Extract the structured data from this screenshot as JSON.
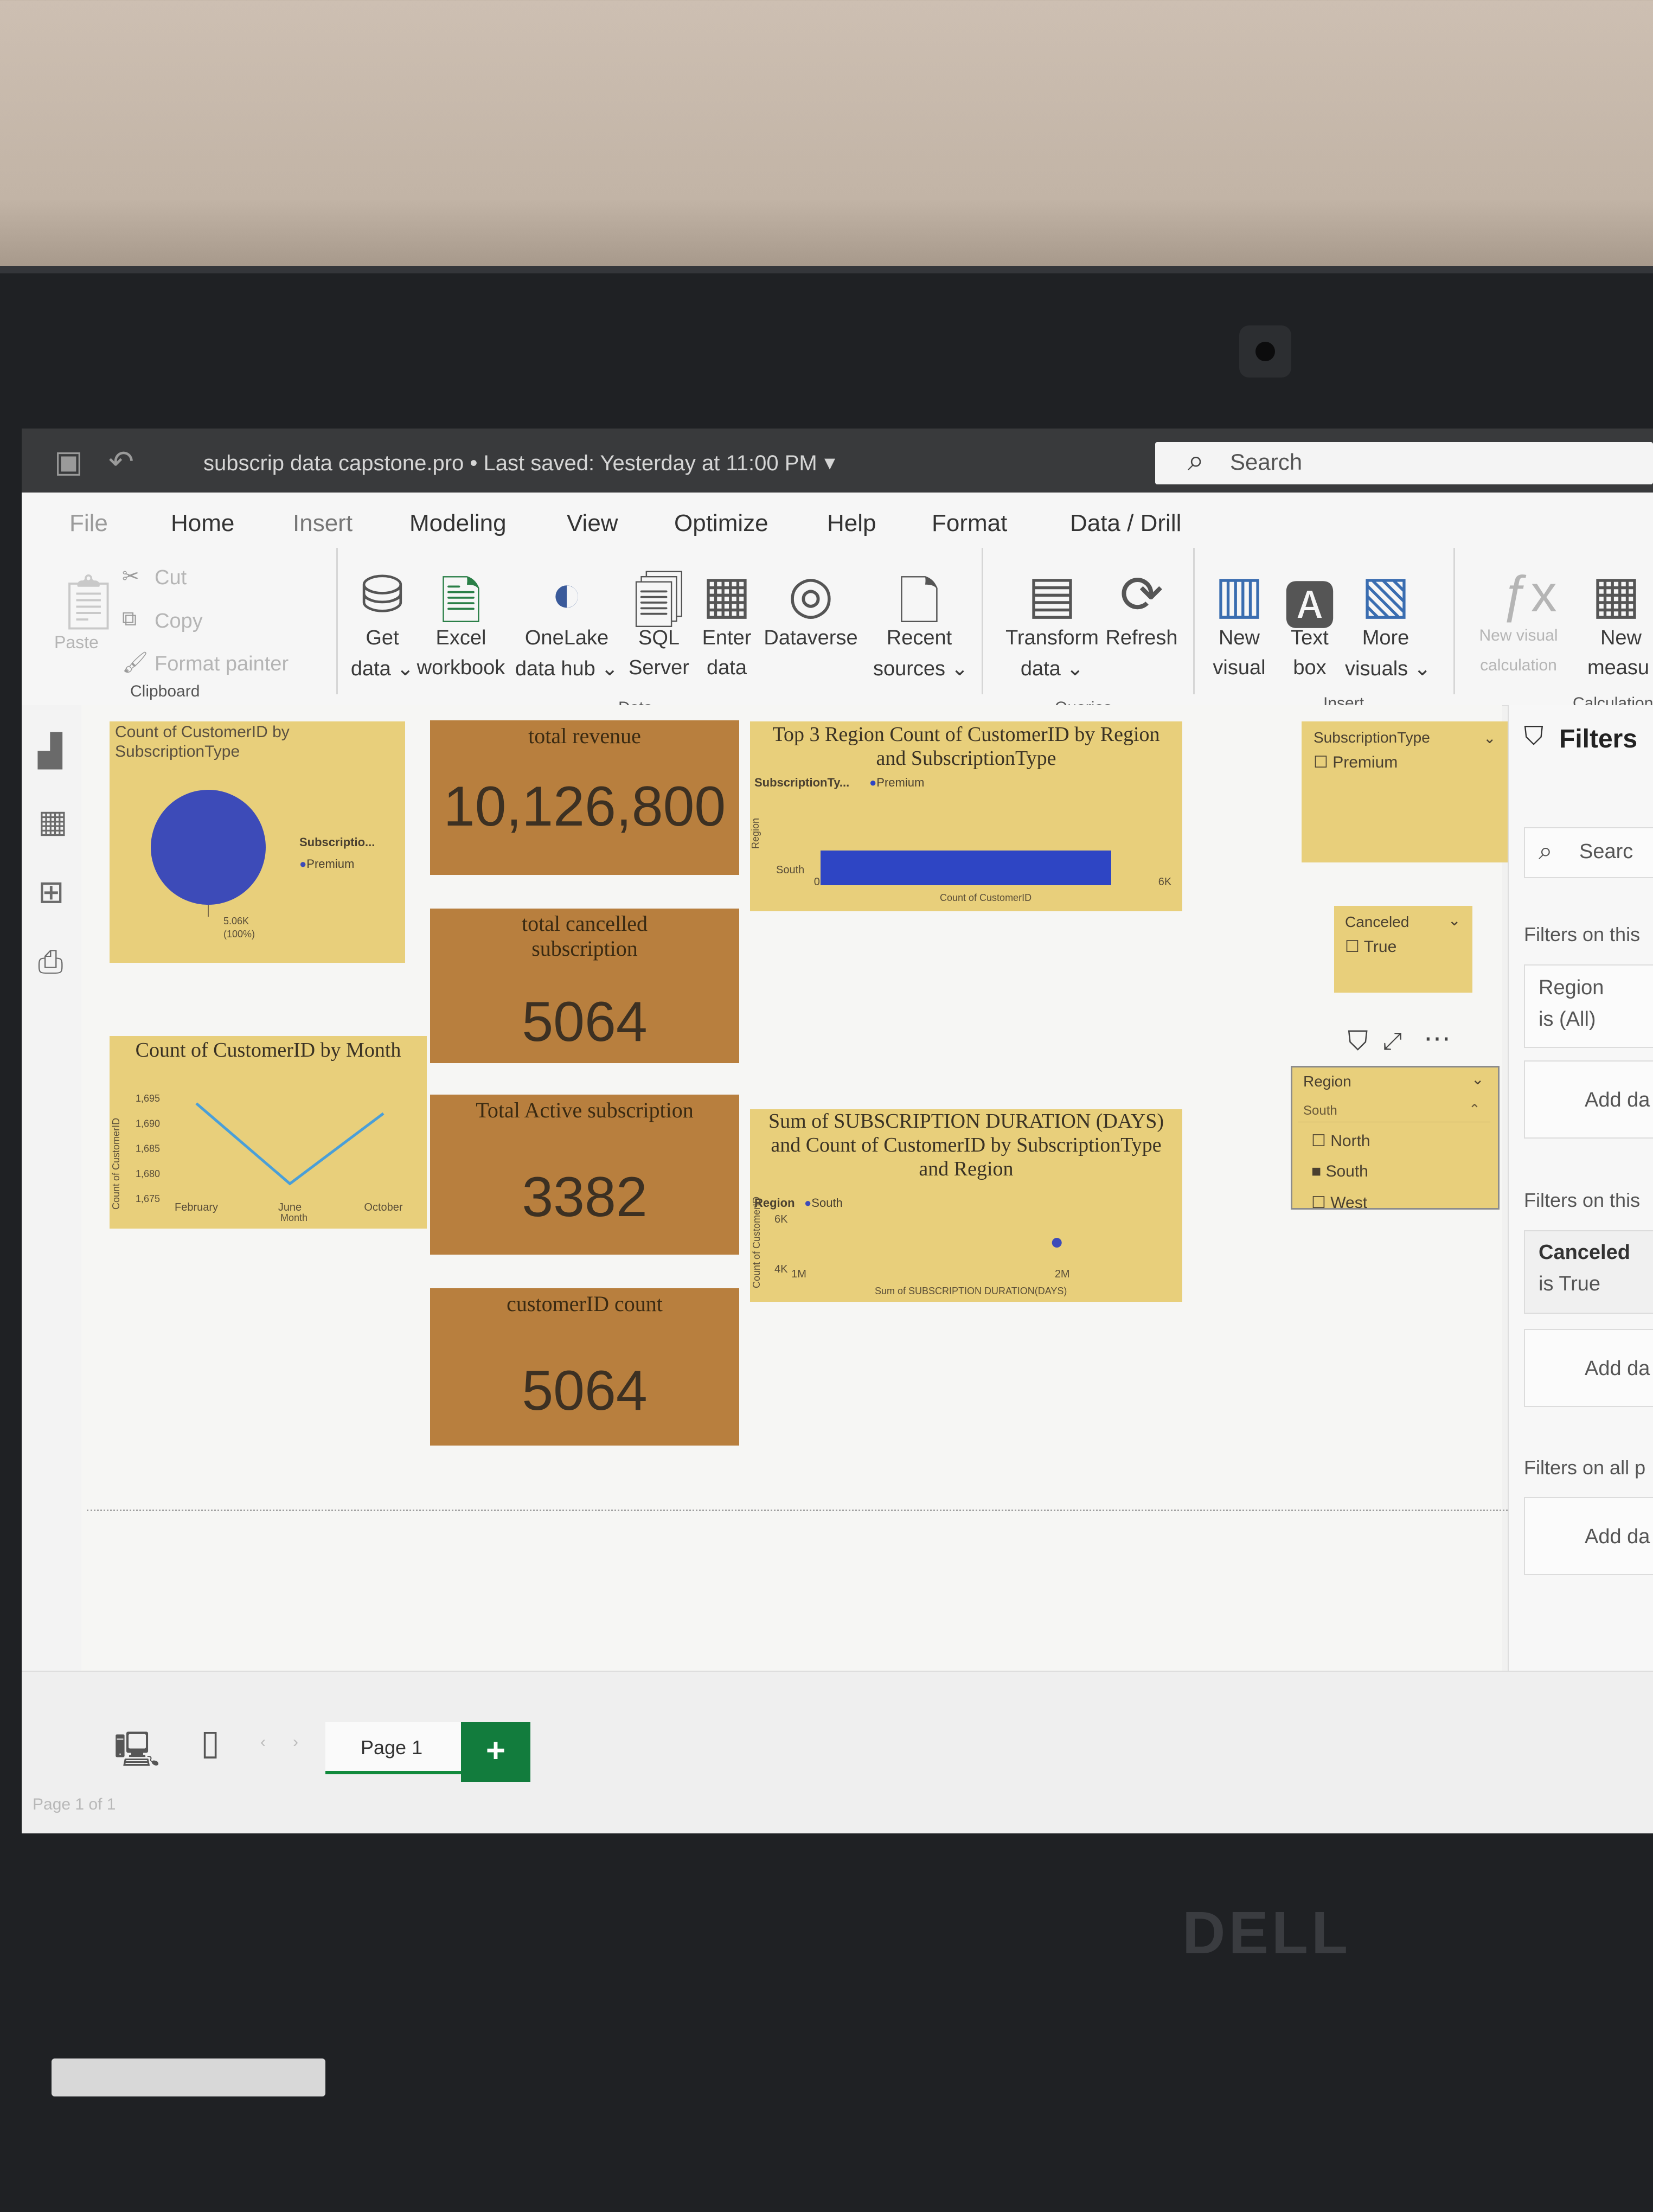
{
  "window": {
    "document_title": "subscrip data capstone.pro • Last saved: Yesterday at 11:00 PM",
    "search_placeholder": "Search"
  },
  "menu_tabs": [
    "File",
    "Home",
    "Insert",
    "Modeling",
    "View",
    "Optimize",
    "Help",
    "Format",
    "Data / Drill"
  ],
  "ribbon": {
    "clipboard": {
      "paste": "Paste",
      "cut": "Cut",
      "copy": "Copy",
      "format_painter": "Format painter",
      "group": "Clipboard"
    },
    "data": {
      "get_data": [
        "Get",
        "data ⌄"
      ],
      "excel": [
        "Excel",
        "workbook"
      ],
      "onelake": [
        "OneLake",
        "data hub ⌄"
      ],
      "sql": [
        "SQL",
        "Server"
      ],
      "enter": [
        "Enter",
        "data"
      ],
      "dataverse": [
        "Dataverse",
        ""
      ],
      "recent": [
        "Recent",
        "sources ⌄"
      ],
      "group": "Data"
    },
    "queries": {
      "transform": [
        "Transform",
        "data ⌄"
      ],
      "refresh": [
        "Refresh",
        ""
      ],
      "group": "Queries"
    },
    "insert": {
      "new_visual": [
        "New",
        "visual"
      ],
      "text_box": [
        "Text",
        "box"
      ],
      "more_visuals": [
        "More",
        "visuals ⌄"
      ],
      "group": "Insert"
    },
    "calculations": {
      "new_visual_calc": [
        "New visual",
        "calculation"
      ],
      "new_measure": [
        "New",
        "measu"
      ],
      "group": "Calculation"
    }
  },
  "visuals": {
    "pie": {
      "title": "Count of CustomerID by SubscriptionType",
      "legend_title": "Subscriptio...",
      "legend_item": "Premium",
      "slice_label": "5.06K",
      "slice_pct": "(100%)",
      "color": "#3d4bb8"
    },
    "kpi_revenue": {
      "title": "total revenue",
      "value": "10,126,800"
    },
    "kpi_cancelled": {
      "title": "total cancelled subscription",
      "value": "5064"
    },
    "kpi_active": {
      "title": "Total Active subscription",
      "value": "3382"
    },
    "kpi_count": {
      "title": "customerID count",
      "value": "5064"
    },
    "bar": {
      "title": "Top 3 Region Count of CustomerID by Region and SubscriptionType",
      "legend_title": "SubscriptionTy...",
      "legend_item": "Premium",
      "ylabel": "Region",
      "xlabel": "Count of CustomerID"
    },
    "line": {
      "title": "Count of CustomerID by Month",
      "ylabel": "Count of CustomerID",
      "xlabel": "Month"
    },
    "scatter": {
      "title": "Sum of SUBSCRIPTION DURATION (DAYS) and Count of CustomerID by SubscriptionType and Region",
      "legend_title": "Region",
      "legend_item": "South",
      "ylabel": "Count of CustomerID",
      "xlabel": "Sum of SUBSCRIPTION DURATION(DAYS)"
    }
  },
  "chart_data": [
    {
      "type": "pie",
      "title": "Count of CustomerID by SubscriptionType",
      "categories": [
        "Premium"
      ],
      "values": [
        5064
      ],
      "labels": [
        "5.06K (100%)"
      ]
    },
    {
      "type": "bar",
      "title": "Top 3 Region Count of CustomerID by Region and SubscriptionType",
      "orientation": "horizontal",
      "categories": [
        "South"
      ],
      "series": [
        {
          "name": "Premium",
          "values": [
            5064
          ]
        }
      ],
      "xlabel": "Count of CustomerID",
      "ylabel": "Region",
      "xlim": [
        0,
        6000
      ],
      "x_ticks": [
        "0K",
        "2K",
        "4K",
        "6K"
      ],
      "color": "#2e45c4"
    },
    {
      "type": "line",
      "title": "Count of CustomerID by Month",
      "categories": [
        "February",
        "June",
        "October"
      ],
      "values": [
        1694,
        1678,
        1692
      ],
      "xlabel": "Month",
      "ylabel": "Count of CustomerID",
      "ylim": [
        1675,
        1695
      ],
      "y_ticks": [
        "1,675",
        "1,680",
        "1,685",
        "1,690",
        "1,695"
      ],
      "color": "#4a9fd8"
    },
    {
      "type": "scatter",
      "title": "Sum of SUBSCRIPTION DURATION (DAYS) and Count of CustomerID by SubscriptionType and Region",
      "series": [
        {
          "name": "South",
          "points": [
            [
              2000000,
              5064
            ]
          ]
        }
      ],
      "xlabel": "Sum of SUBSCRIPTION DURATION(DAYS)",
      "ylabel": "Count of CustomerID",
      "x_ticks": [
        "1M",
        "2M"
      ],
      "y_ticks": [
        "4K",
        "6K"
      ],
      "xlim": [
        1000000,
        2400000
      ],
      "ylim": [
        4000,
        6500
      ],
      "color": "#3d4bb8"
    }
  ],
  "slicers": {
    "subscription": {
      "title": "SubscriptionType",
      "options": [
        {
          "label": "Premium",
          "checked": false
        }
      ]
    },
    "canceled": {
      "title": "Canceled",
      "options": [
        {
          "label": "True",
          "checked": false
        }
      ]
    },
    "region": {
      "title": "Region",
      "selected": "South",
      "options": [
        {
          "label": "North",
          "checked": false
        },
        {
          "label": "South",
          "checked": true
        },
        {
          "label": "West",
          "checked": false
        }
      ]
    }
  },
  "filters_pane": {
    "title": "Filters",
    "search": "Searc",
    "on_this_visual": "Filters on this",
    "region_filter": {
      "name": "Region",
      "state": "is (All)"
    },
    "add_data": "Add da",
    "on_this_page": "Filters on this",
    "canceled_filter": {
      "name": "Canceled",
      "state": "is True"
    },
    "on_all_pages": "Filters on all p"
  },
  "footer": {
    "page_tab": "Page 1",
    "add": "+",
    "page_status": "Page 1 of 1"
  },
  "laptop": {
    "brand": "DELL"
  }
}
